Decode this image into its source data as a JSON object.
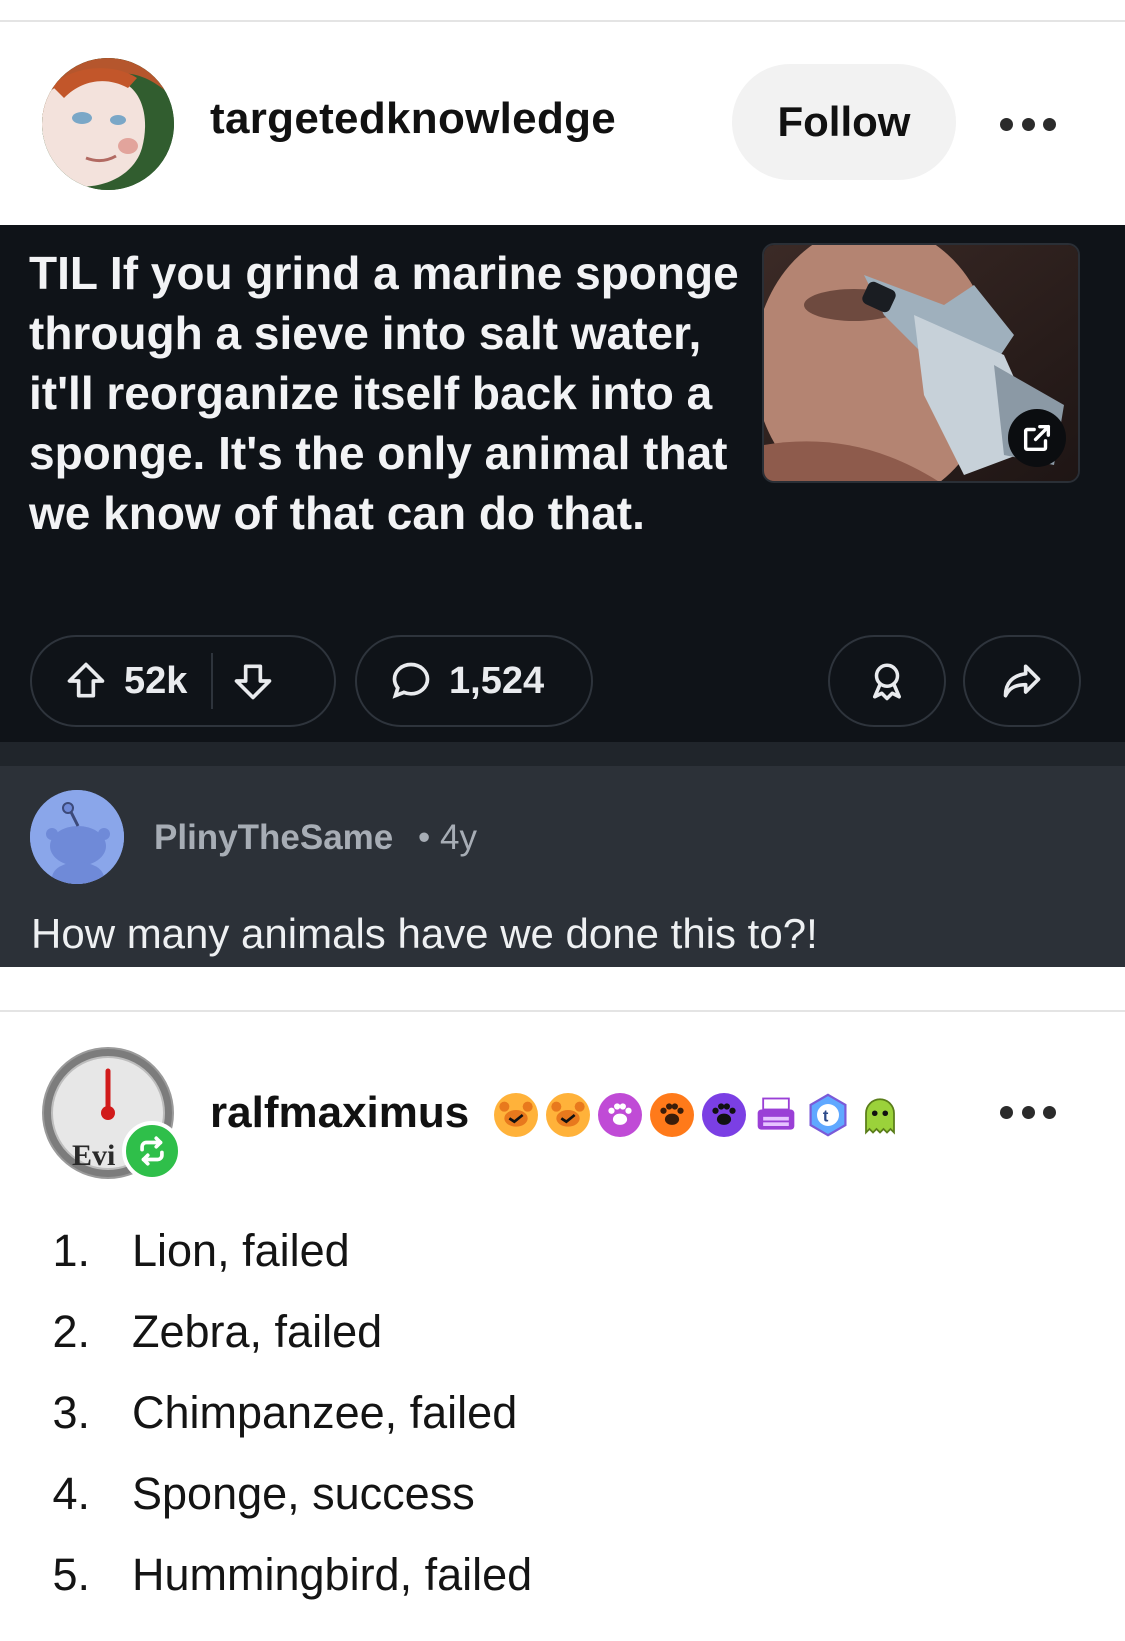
{
  "post": {
    "author": "targetedknowledge",
    "follow_label": "Follow",
    "title": "TIL If you grind a marine sponge through a sieve into salt water, it'll reorganize itself back into a sponge. It's the only animal that we know of that can do that.",
    "upvotes": "52k",
    "comments": "1,524"
  },
  "comment": {
    "author": "PlinyTheSame",
    "age": "• 4y",
    "text": "How many animals have we done this to?!"
  },
  "reply": {
    "author": "ralfmaximus",
    "avatar_text": "Evi",
    "badges": [
      "crab-badge",
      "crab-badge",
      "paw-badge",
      "paw-badge",
      "paw-badge",
      "typewriter-badge",
      "tumblr-badge",
      "ghost-badge"
    ],
    "list": [
      {
        "num": "1.",
        "text": "Lion, failed"
      },
      {
        "num": "2.",
        "text": "Zebra, failed"
      },
      {
        "num": "3.",
        "text": "Chimpanzee, failed"
      },
      {
        "num": "4.",
        "text": "Sponge, success"
      },
      {
        "num": "5.",
        "text": "Hummingbird, failed"
      }
    ]
  },
  "colors": {
    "dark_bg": "#0f1318",
    "comment_bg": "#2c3138",
    "follow_bg": "#f2f2f2",
    "reblog_green": "#2fbf4a"
  }
}
